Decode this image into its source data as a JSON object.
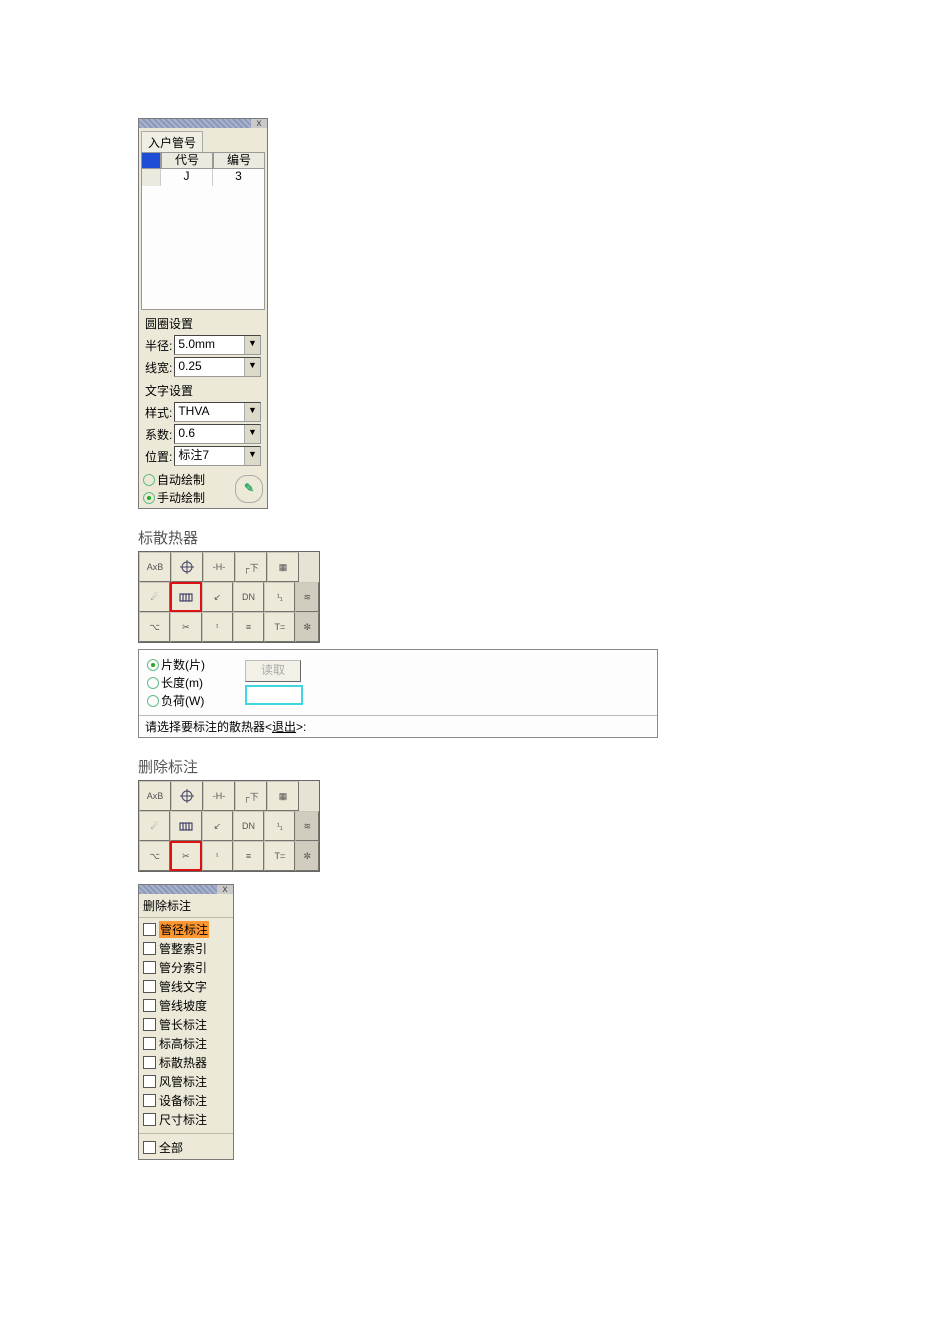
{
  "panel1": {
    "tab": "入户管号",
    "columns": {
      "code": "代号",
      "number": "编号"
    },
    "rows": [
      {
        "code": "J",
        "number": "3"
      }
    ],
    "circle_group": "圆圈设置",
    "radius_label": "半径:",
    "radius_value": "5.0mm",
    "width_label": "线宽:",
    "width_value": "0.25",
    "text_group": "文字设置",
    "style_label": "样式:",
    "style_value": "THVA",
    "coef_label": "系数:",
    "coef_value": "0.6",
    "pos_label": "位置:",
    "pos_value": "标注7",
    "auto_draw": "自动绘制",
    "manual_draw": "手动绘制"
  },
  "heading1": "标散热器",
  "options": {
    "piece": "片数(片)",
    "length": "长度(m)",
    "load": "负荷(W)",
    "read": "读取",
    "prompt_head": "请选择要标注的散热器<",
    "prompt_u": "退出",
    "prompt_tail": ">:"
  },
  "heading2": "删除标注",
  "panel3": {
    "title": "删除标注",
    "items": [
      "管径标注",
      "管整索引",
      "管分索引",
      "管线文字",
      "管线坡度",
      "管长标注",
      "标高标注",
      "标散热器",
      "风管标注",
      "设备标注",
      "尺寸标注"
    ],
    "all": "全部"
  }
}
